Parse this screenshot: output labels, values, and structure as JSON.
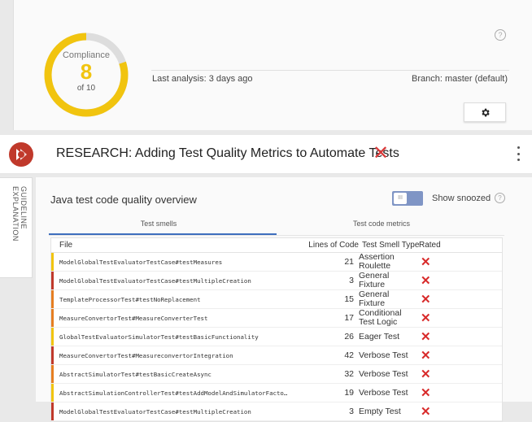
{
  "compliance": {
    "title": "Compliance",
    "value": "8",
    "subtitle": "of 10",
    "score_fraction": 0.8,
    "ring_color": "#f1c40f",
    "track_color": "#dddddd"
  },
  "analysis": {
    "last_analysis": "Last analysis: 3 days ago",
    "branch": "Branch: master (default)"
  },
  "icons": {
    "help_top": "help-icon",
    "settings": "gear-icon",
    "logo": "app-logo",
    "close": "close-icon",
    "menu": "kebab-menu-icon"
  },
  "panel": {
    "title": "RESEARCH: Adding Test Quality Metrics to Automate Tests",
    "close_symbol": "✕",
    "side_tab": "GUIDELINE EXPLANATION"
  },
  "overview": {
    "title": "Java test code quality overview",
    "toggle_text": "III",
    "show_snoozed": "Show snoozed",
    "help_glyph": "?"
  },
  "tabs": [
    {
      "label": "Test smells",
      "active": true
    },
    {
      "label": "Test code metrics",
      "active": false
    }
  ],
  "table": {
    "headers": {
      "file": "File",
      "loc": "Lines of Code",
      "type": "Test Smell Type",
      "rated": "Rated"
    },
    "rated_symbol": "✕",
    "rows": [
      {
        "file": "ModelGlobalTestEvaluatorTestCase#testMeasures",
        "loc": "21",
        "type": "Assertion Roulette",
        "color": "#f1c40f"
      },
      {
        "file": "ModelGlobalTestEvaluatorTestCase#testMultipleCreation",
        "loc": "3",
        "type": "General Fixture",
        "color": "#c0392b"
      },
      {
        "file": "TemplateProcessorTest#testNoReplacement",
        "loc": "15",
        "type": "General Fixture",
        "color": "#e67e22"
      },
      {
        "file": "MeasureConvertorTest#MeasureConverterTest",
        "loc": "17",
        "type": "Conditional Test Logic",
        "color": "#e67e22"
      },
      {
        "file": "GlobalTestEvaluatorSimulatorTest#testBasicFunctionality",
        "loc": "26",
        "type": "Eager Test",
        "color": "#f1c40f"
      },
      {
        "file": "MeasureConvertorTest#MeasureconvertorIntegration",
        "loc": "42",
        "type": "Verbose Test",
        "color": "#c0392b"
      },
      {
        "file": "AbstractSimulatorTest#testBasicCreateAsync",
        "loc": "32",
        "type": "Verbose Test",
        "color": "#e67e22"
      },
      {
        "file": "AbstractSimulationControllerTest#testAddModelAndSimulatorFacto…",
        "loc": "19",
        "type": "Verbose Test",
        "color": "#f1c40f"
      },
      {
        "file": "ModelGlobalTestEvaluatorTestCase#testMultipleCreation",
        "loc": "3",
        "type": "Empty Test",
        "color": "#c0392b"
      }
    ]
  }
}
